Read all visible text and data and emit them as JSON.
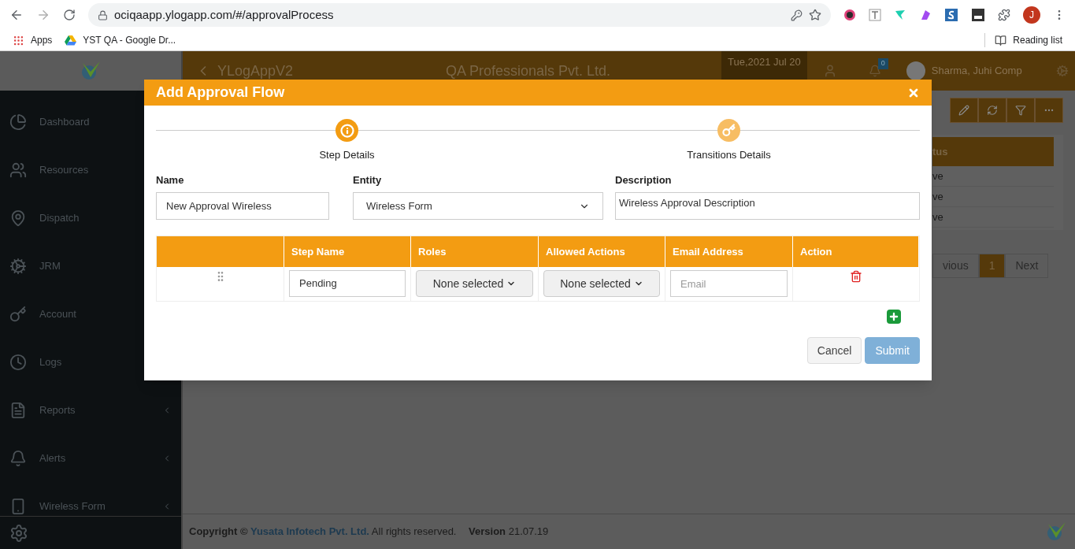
{
  "browser": {
    "url": "ociqaapp.ylogapp.com/#/approvalProcess",
    "bookmarks": [
      "Apps",
      "YST QA - Google Dr..."
    ],
    "reading_list": "Reading list",
    "profile": "J"
  },
  "header": {
    "title": "YLogAppV2",
    "company": "QA Professionals Pvt. Ltd.",
    "date": "Tue,2021 Jul 20",
    "badge": "0",
    "user": "Sharma, Juhi Comp"
  },
  "sidebar": {
    "items": [
      {
        "label": "Dashboard",
        "kind": "pie"
      },
      {
        "label": "Resources",
        "kind": "resources"
      },
      {
        "label": "Dispatch",
        "kind": "pin"
      },
      {
        "label": "JRM",
        "kind": "gear"
      },
      {
        "label": "Account",
        "kind": "key"
      },
      {
        "label": "Logs",
        "kind": "clock"
      },
      {
        "label": "Reports",
        "kind": "report",
        "submenu": true
      },
      {
        "label": "Alerts",
        "kind": "bell",
        "submenu": true
      },
      {
        "label": "Wireless Form",
        "kind": "phone",
        "submenu": true
      }
    ]
  },
  "background": {
    "table_header": "tus",
    "rows": [
      "ve",
      "ve",
      "ve"
    ],
    "pagination": [
      {
        "label": "vious",
        "selected": false
      },
      {
        "label": "1",
        "selected": true
      },
      {
        "label": "Next",
        "selected": false
      }
    ]
  },
  "footer": {
    "copyright": "Copyright ©",
    "company": "Yusata Infotech Pvt. Ltd.",
    "rights": "All rights reserved.",
    "version_label": "Version",
    "version": "21.07.19"
  },
  "modal": {
    "title": "Add Approval Flow",
    "steps": [
      {
        "label": "Step Details",
        "kind": "info",
        "selected": true
      },
      {
        "label": "Transitions Details",
        "kind": "key",
        "selected": false
      }
    ],
    "fields": [
      {
        "label": "Name",
        "kind": "text",
        "value": "New Approval Wireless"
      },
      {
        "label": "Entity",
        "kind": "select",
        "value": "Wireless Form"
      },
      {
        "label": "Description",
        "kind": "textarea",
        "value": "Wireless Approval Description"
      }
    ],
    "table": {
      "columns": [
        "Step Name",
        "Roles",
        "Allowed Actions",
        "Email Address",
        "Action"
      ],
      "rows": [
        {
          "step_name": "Pending",
          "roles": "None selected",
          "actions": "None selected",
          "email_placeholder": "Email"
        }
      ]
    },
    "buttons": [
      {
        "label": "Cancel",
        "kind": "cancel",
        "disabled": false
      },
      {
        "label": "Submit",
        "kind": "submit",
        "disabled": true
      }
    ]
  }
}
